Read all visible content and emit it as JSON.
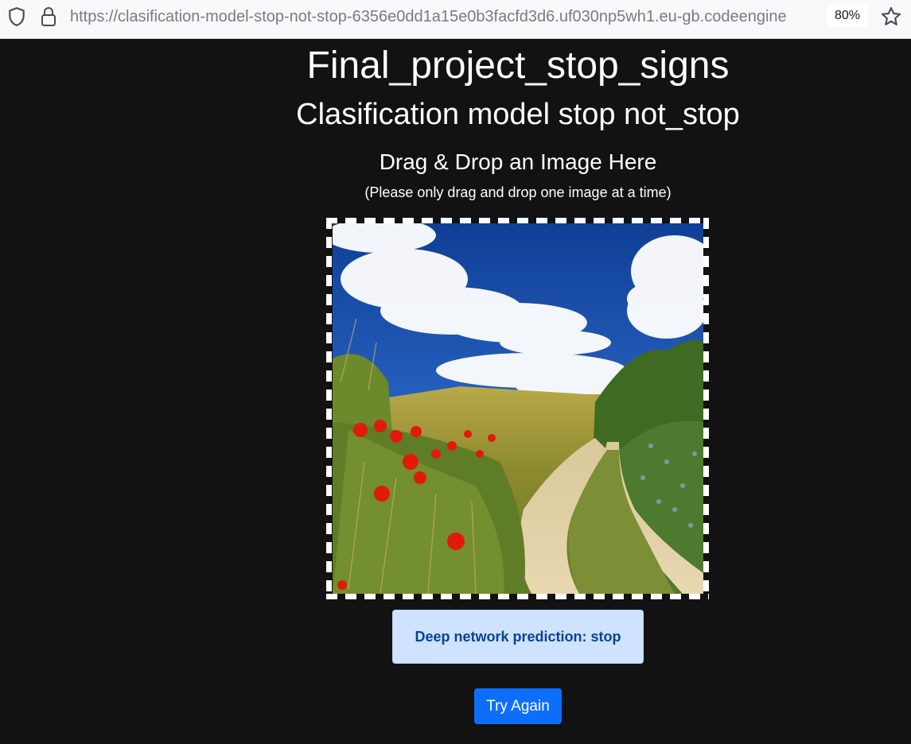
{
  "browser": {
    "url": "https://clasification-model-stop-not-stop-6356e0dd1a15e0b3facfd3d6.uf030np5wh1.eu-gb.codeengine",
    "zoom": "80%",
    "icons": [
      "shield-icon",
      "lock-icon",
      "star-icon"
    ]
  },
  "page": {
    "title": "Final_project_stop_signs",
    "subtitle": "Clasification model stop not_stop"
  },
  "dropzone": {
    "heading": "Drag & Drop an Image Here",
    "note": "(Please only drag and drop one image at a time)"
  },
  "result": {
    "prediction_text": "Deep network prediction: stop"
  },
  "actions": {
    "try_again_label": "Try Again"
  },
  "colors": {
    "background": "#121212",
    "alert_bg": "#cfe2ff",
    "alert_text": "#084298",
    "button_primary": "#0d6efd"
  }
}
